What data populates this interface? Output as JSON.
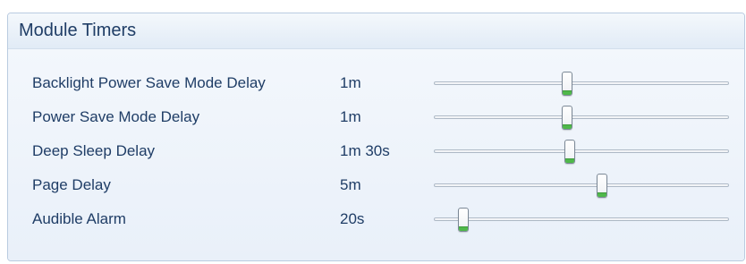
{
  "panel": {
    "title": "Module Timers"
  },
  "timers": [
    {
      "label": "Backlight Power Save Mode Delay",
      "value": "1m",
      "level": 0.45
    },
    {
      "label": "Power Save Mode Delay",
      "value": "1m",
      "level": 0.45
    },
    {
      "label": "Deep Sleep Delay",
      "value": "1m 30s",
      "level": 0.46
    },
    {
      "label": "Page Delay",
      "value": "5m",
      "level": 0.57
    },
    {
      "label": "Audible Alarm",
      "value": "20s",
      "level": 0.1
    }
  ],
  "colors": {
    "text": "#1f3d66",
    "thumb_accent": "#4fb84a",
    "panel_border": "#b9cbe0"
  }
}
